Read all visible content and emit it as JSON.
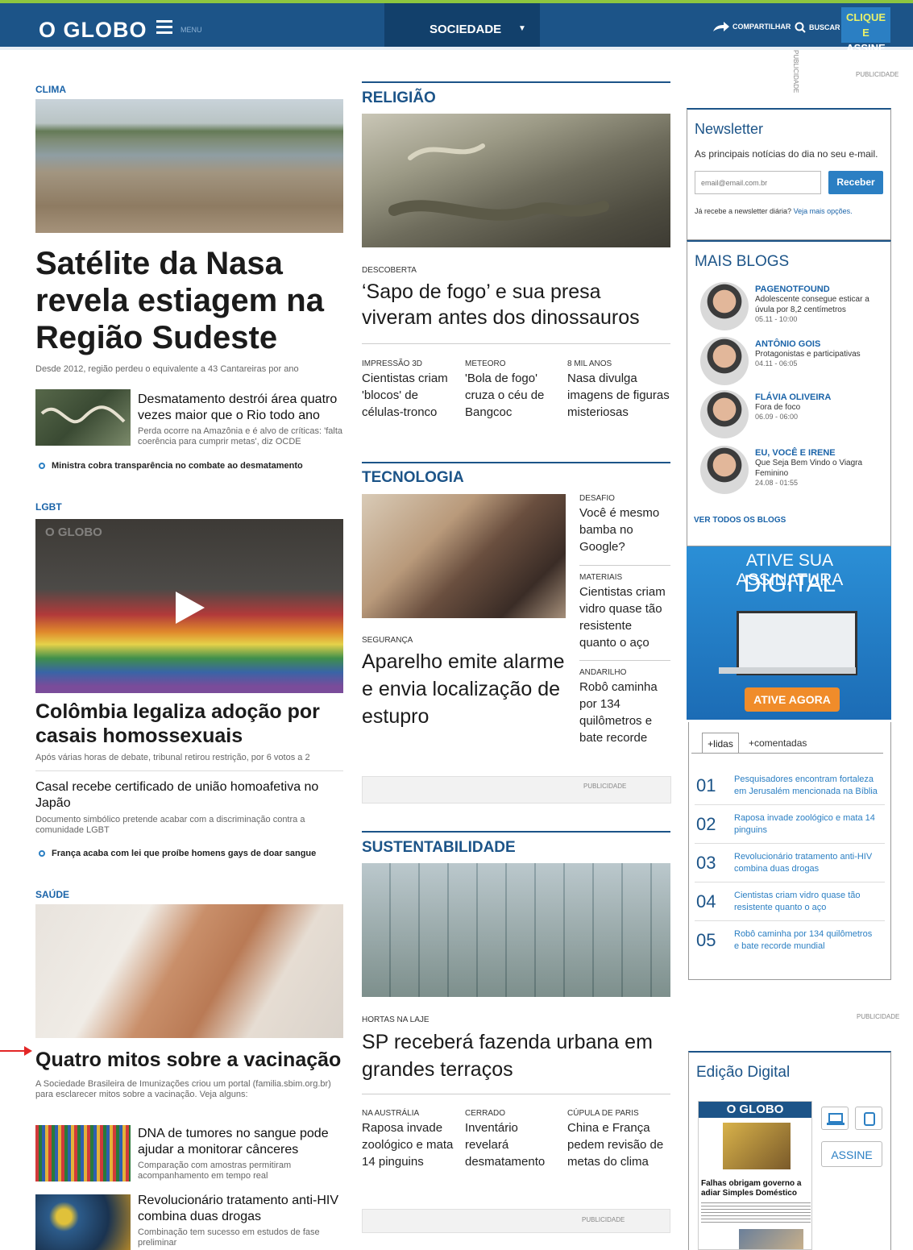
{
  "header": {
    "logo": "O GLOBO",
    "menu_label": "MENU",
    "section": "SOCIEDADE",
    "share_label": "COMPARTILHAR",
    "search_label": "BUSCAR",
    "subscribe_line1": "CLIQUE E",
    "subscribe_line2": "ASSINE",
    "colors": {
      "bar": "#1c5488",
      "accent": "#8dc63f",
      "link": "#1a63a8"
    }
  },
  "left": {
    "clima": {
      "kicker": "CLIMA",
      "headline": "Satélite da Nasa revela estiagem na Região Sudeste",
      "summary": "Desde 2012, região perdeu o equivalente a 43 Cantareiras por ano",
      "related_title": "Desmatamento destrói área quatro vezes maior que o Rio todo ano",
      "related_summary": "Perda ocorre na Amazônia e é alvo de críticas: 'falta coerência para cumprir metas', diz OCDE",
      "bullet": "Ministra cobra transparência no combate ao desmatamento"
    },
    "lgbt": {
      "kicker": "LGBT",
      "watermark": "O GLOBO",
      "headline": "Colômbia legaliza adoção por casais homossexuais",
      "summary": "Após várias horas de debate, tribunal retirou restrição, por 6 votos a 2",
      "related_title": "Casal recebe certificado de união homoafetiva no Japão",
      "related_summary": "Documento simbólico pretende acabar com a discriminação contra a comunidade LGBT",
      "bullet": "França acaba com lei que proíbe homens gays de doar sangue"
    },
    "saude": {
      "kicker": "SAÚDE",
      "headline": "Quatro mitos sobre a vacinação",
      "summary": "A Sociedade Brasileira de Imunizações criou um portal (familia.sbim.org.br) para esclarecer mitos sobre a vacinação. Veja alguns:",
      "item1_title": "DNA de tumores no sangue pode ajudar a monitorar cânceres",
      "item1_summary": "Comparação com amostras permitiram acompanhamento em tempo real",
      "item2_title": "Revolucionário tratamento anti-HIV combina duas drogas",
      "item2_summary": "Combinação tem sucesso em estudos de fase preliminar"
    }
  },
  "middle": {
    "religiao": {
      "title": "RELIGIÃO",
      "category": "DESCOBERTA",
      "headline": "‘Sapo de fogo’ e sua presa viveram antes dos dinossauros",
      "cols": [
        {
          "cat": "IMPRESSÃO 3D",
          "text": "Cientistas criam 'blocos' de células-tronco"
        },
        {
          "cat": "METEORO",
          "text": "'Bola de fogo' cruza o céu de Bangcoc"
        },
        {
          "cat": "8 MIL ANOS",
          "text": "Nasa divulga imagens de figuras misteriosas"
        }
      ]
    },
    "tecnologia": {
      "title": "TECNOLOGIA",
      "main_cat": "SEGURANÇA",
      "main_headline": "Aparelho emite alarme e envia localização de estupro",
      "side": [
        {
          "cat": "DESAFIO",
          "text": "Você é mesmo bamba no Google?"
        },
        {
          "cat": "MATERIAIS",
          "text": "Cientistas criam vidro quase tão resistente quanto o aço"
        },
        {
          "cat": "ANDARILHO",
          "text": "Robô caminha por 134 quilômetros e bate recorde"
        }
      ],
      "pub": "PUBLICIDADE"
    },
    "sustentabilidade": {
      "title": "SUSTENTABILIDADE",
      "category": "HORTAS NA LAJE",
      "headline": "SP receberá fazenda urbana em grandes terraços",
      "cols": [
        {
          "cat": "NA AUSTRÁLIA",
          "text": "Raposa invade zoológico e mata 14 pinguins"
        },
        {
          "cat": "CERRADO",
          "text": "Inventário revelará desmatamento"
        },
        {
          "cat": "CÚPULA DE PARIS",
          "text": "China e França pedem revisão de metas do clima"
        }
      ],
      "pub": "PUBLICIDADE"
    }
  },
  "right": {
    "pub_vertical": "PUBLICIDADE",
    "pub_top": "PUBLICIDADE",
    "newsletter": {
      "title": "Newsletter",
      "desc": "As principais notícias do dia no seu e-mail.",
      "placeholder": "email@email.com.br",
      "button": "Receber",
      "note_prefix": "Já recebe a newsletter diária?",
      "note_link": "Veja mais opções."
    },
    "blogs": {
      "title": "MAIS BLOGS",
      "items": [
        {
          "name": "PAGENOTFOUND",
          "text": "Adolescente consegue esticar a úvula por 8,2 centímetros",
          "date": "05.11 - 10:00"
        },
        {
          "name": "ANTÔNIO GOIS",
          "text": "Protagonistas e participativas",
          "date": "04.11 - 06:05"
        },
        {
          "name": "FLÁVIA OLIVEIRA",
          "text": "Fora de foco",
          "date": "06.09 - 06:00"
        },
        {
          "name": "EU, VOCÊ E IRENE",
          "text": "Que Seja Bem Vindo o Viagra Feminino",
          "date": "24.08 - 01:55"
        }
      ],
      "see_all": "VER TODOS OS BLOGS"
    },
    "ad": {
      "line1": "ATIVE SUA ASSINATURA",
      "line2": "DIGITAL",
      "cta": "ATIVE AGORA"
    },
    "ranking": {
      "tab1": "+lidas",
      "tab2": "+comentadas",
      "items": [
        {
          "n": "01",
          "text": "Pesquisadores encontram fortaleza em Jerusalém mencionada na Bíblia"
        },
        {
          "n": "02",
          "text": "Raposa invade zoológico e mata 14 pinguins"
        },
        {
          "n": "03",
          "text": "Revolucionário tratamento anti-HIV combina duas drogas"
        },
        {
          "n": "04",
          "text": "Cientistas criam vidro quase tão resistente quanto o aço"
        },
        {
          "n": "05",
          "text": "Robô caminha por 134 quilômetros e bate recorde mundial"
        }
      ]
    },
    "pub_mid": "PUBLICIDADE",
    "edition": {
      "title": "Edição Digital",
      "paper_logo": "O GLOBO",
      "paper_headline": "Falhas obrigam governo a adiar Simples Doméstico",
      "button": "ASSINE"
    }
  }
}
